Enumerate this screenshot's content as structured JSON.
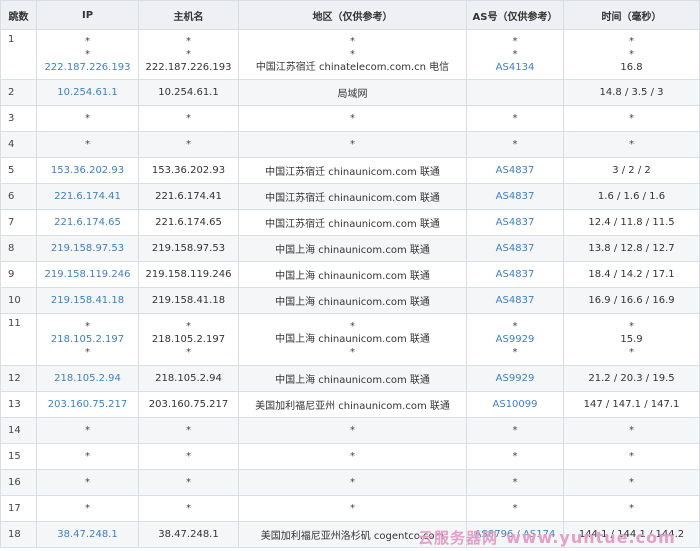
{
  "headers": [
    "跳数",
    "IP",
    "主机名",
    "地区（仅供参考）",
    "AS号（仅供参考）",
    "时间（毫秒）"
  ],
  "rows": [
    {
      "hop": "1",
      "ip": [
        "*",
        "*",
        "222.187.226.193"
      ],
      "host": [
        "*",
        "*",
        "222.187.226.193"
      ],
      "region": [
        "*",
        "*",
        "中国江苏宿迁 chinatelecom.com.cn 电信"
      ],
      "asn": [
        "*",
        "*",
        "AS4134"
      ],
      "time": [
        "*",
        "*",
        "16.8"
      ]
    },
    {
      "hop": "2",
      "ip": [
        "10.254.61.1"
      ],
      "host": [
        "10.254.61.1"
      ],
      "region": [
        "局域网"
      ],
      "asn": [
        ""
      ],
      "time": [
        "14.8 / 3.5 / 3"
      ]
    },
    {
      "hop": "3",
      "ip": [
        "*"
      ],
      "host": [
        "*"
      ],
      "region": [
        "*"
      ],
      "asn": [
        "*"
      ],
      "time": [
        "*"
      ]
    },
    {
      "hop": "4",
      "ip": [
        "*"
      ],
      "host": [
        "*"
      ],
      "region": [
        "*"
      ],
      "asn": [
        "*"
      ],
      "time": [
        "*"
      ]
    },
    {
      "hop": "5",
      "ip": [
        "153.36.202.93"
      ],
      "host": [
        "153.36.202.93"
      ],
      "region": [
        "中国江苏宿迁 chinaunicom.com 联通"
      ],
      "asn": [
        "AS4837"
      ],
      "time": [
        "3 / 2 / 2"
      ]
    },
    {
      "hop": "6",
      "ip": [
        "221.6.174.41"
      ],
      "host": [
        "221.6.174.41"
      ],
      "region": [
        "中国江苏宿迁 chinaunicom.com 联通"
      ],
      "asn": [
        "AS4837"
      ],
      "time": [
        "1.6 / 1.6 / 1.6"
      ]
    },
    {
      "hop": "7",
      "ip": [
        "221.6.174.65"
      ],
      "host": [
        "221.6.174.65"
      ],
      "region": [
        "中国江苏宿迁 chinaunicom.com 联通"
      ],
      "asn": [
        "AS4837"
      ],
      "time": [
        "12.4 / 11.8 / 11.5"
      ]
    },
    {
      "hop": "8",
      "ip": [
        "219.158.97.53"
      ],
      "host": [
        "219.158.97.53"
      ],
      "region": [
        "中国上海 chinaunicom.com 联通"
      ],
      "asn": [
        "AS4837"
      ],
      "time": [
        "13.8 / 12.8 / 12.7"
      ]
    },
    {
      "hop": "9",
      "ip": [
        "219.158.119.246"
      ],
      "host": [
        "219.158.119.246"
      ],
      "region": [
        "中国上海 chinaunicom.com 联通"
      ],
      "asn": [
        "AS4837"
      ],
      "time": [
        "18.4 / 14.2 / 17.1"
      ]
    },
    {
      "hop": "10",
      "ip": [
        "219.158.41.18"
      ],
      "host": [
        "219.158.41.18"
      ],
      "region": [
        "中国上海 chinaunicom.com 联通"
      ],
      "asn": [
        "AS4837"
      ],
      "time": [
        "16.9 / 16.6 / 16.9"
      ]
    },
    {
      "hop": "11",
      "ip": [
        "*",
        "218.105.2.197",
        "*"
      ],
      "host": [
        "*",
        "218.105.2.197",
        "*"
      ],
      "region": [
        "*",
        "中国上海 chinaunicom.com 联通",
        "*"
      ],
      "asn": [
        "*",
        "AS9929",
        "*"
      ],
      "time": [
        "*",
        "15.9",
        "*"
      ]
    },
    {
      "hop": "12",
      "ip": [
        "218.105.2.94"
      ],
      "host": [
        "218.105.2.94"
      ],
      "region": [
        "中国上海 chinaunicom.com 联通"
      ],
      "asn": [
        "AS9929"
      ],
      "time": [
        "21.2 / 20.3 / 19.5"
      ]
    },
    {
      "hop": "13",
      "ip": [
        "203.160.75.217"
      ],
      "host": [
        "203.160.75.217"
      ],
      "region": [
        "美国加利福尼亚州 chinaunicom.com 联通"
      ],
      "asn": [
        "AS10099"
      ],
      "time": [
        "147 / 147.1 / 147.1"
      ]
    },
    {
      "hop": "14",
      "ip": [
        "*"
      ],
      "host": [
        "*"
      ],
      "region": [
        "*"
      ],
      "asn": [
        "*"
      ],
      "time": [
        "*"
      ]
    },
    {
      "hop": "15",
      "ip": [
        "*"
      ],
      "host": [
        "*"
      ],
      "region": [
        "*"
      ],
      "asn": [
        "*"
      ],
      "time": [
        "*"
      ]
    },
    {
      "hop": "16",
      "ip": [
        "*"
      ],
      "host": [
        "*"
      ],
      "region": [
        "*"
      ],
      "asn": [
        "*"
      ],
      "time": [
        "*"
      ]
    },
    {
      "hop": "17",
      "ip": [
        "*"
      ],
      "host": [
        "*"
      ],
      "region": [
        "*"
      ],
      "asn": [
        "*"
      ],
      "time": [
        "*"
      ]
    },
    {
      "hop": "18",
      "ip": [
        "38.47.248.1"
      ],
      "host": [
        "38.47.248.1"
      ],
      "region": [
        "美国加利福尼亚州洛杉矶 cogentco.com"
      ],
      "asn": [
        "AS8796 / AS174"
      ],
      "time": [
        "144.1 / 144.1 / 144.2"
      ]
    }
  ],
  "watermark": {
    "cn": "云服务器网",
    "url": "www.yuntue.com"
  },
  "colors": {
    "link": "#3f7fc0",
    "header_bg": "#eef0f4",
    "stripe": "#f5f6f8",
    "border": "#d9dee5",
    "watermark": "#e3a0c8"
  }
}
